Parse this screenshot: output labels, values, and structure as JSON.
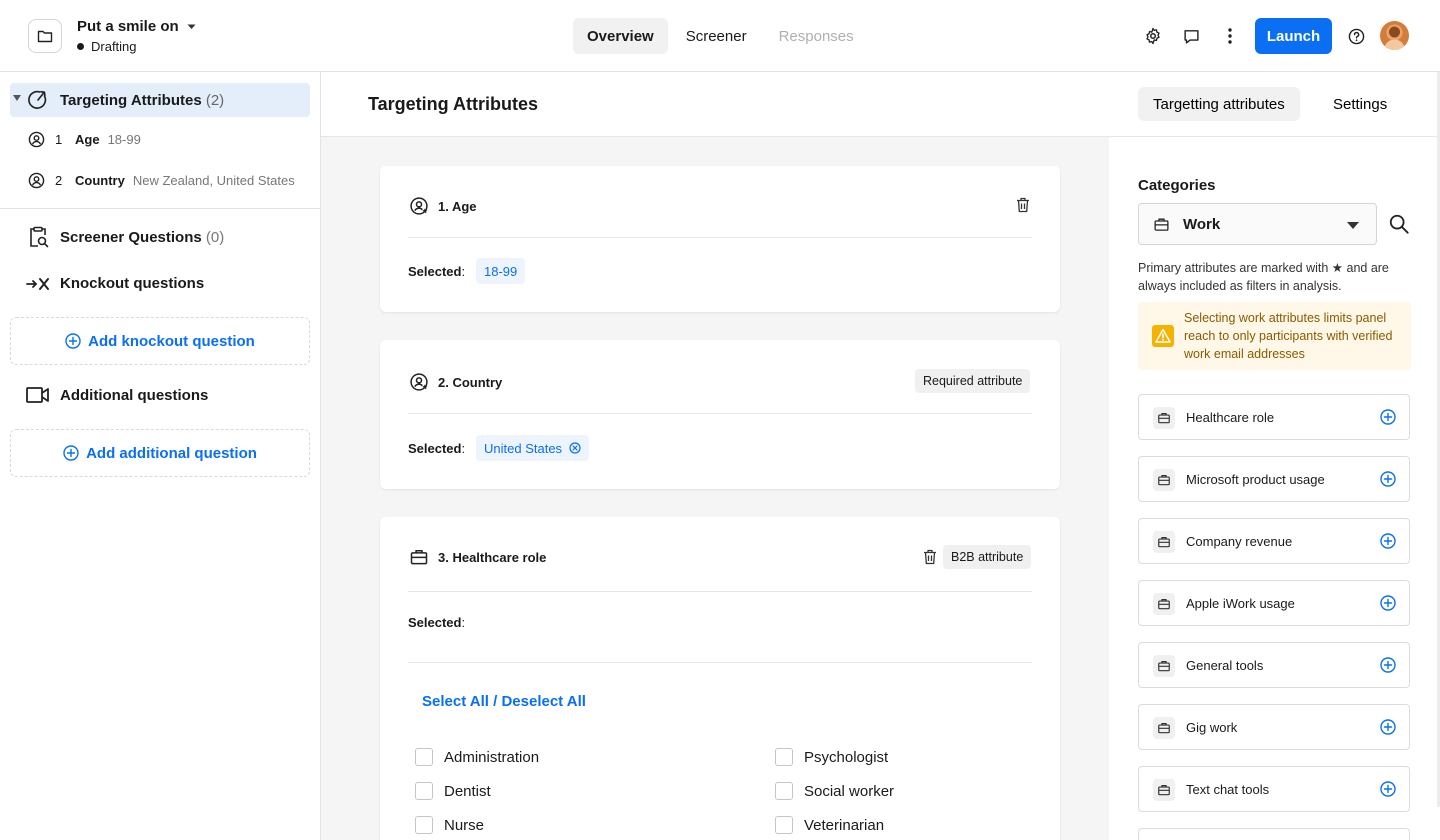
{
  "header": {
    "project_title": "Put a smile on",
    "status": "Drafting",
    "tabs": [
      "Overview",
      "Screener",
      "Responses"
    ],
    "launch_label": "Launch",
    "icons": [
      "settings-icon",
      "chat-icon",
      "more-icon",
      "help-icon"
    ]
  },
  "sidebar": {
    "targeting": {
      "label": "Targeting Attributes",
      "count": "(2)"
    },
    "attributes": [
      {
        "num": "1",
        "name": "Age",
        "value": "18-99"
      },
      {
        "num": "2",
        "name": "Country",
        "value": "New Zealand, United States"
      }
    ],
    "screener": {
      "label": "Screener Questions",
      "count": "(0)"
    },
    "knockout": {
      "label": "Knockout questions",
      "add_label": "Add knockout question"
    },
    "additional": {
      "label": "Additional questions",
      "add_label": "Add additional question"
    }
  },
  "main": {
    "title": "Targeting Attributes",
    "selected_label": "Selected",
    "cards": [
      {
        "title": "1. Age",
        "chip": "18-99"
      },
      {
        "title": "2. Country",
        "badge": "Required attribute",
        "chip": "United States"
      },
      {
        "title": "3. Healthcare role",
        "badge": "B2B attribute",
        "select_all": "Select All / Deselect All",
        "options_left": [
          "Administration",
          "Dentist",
          "Nurse"
        ],
        "options_right": [
          "Psychologist",
          "Social worker",
          "Veterinarian"
        ]
      }
    ]
  },
  "right_panel": {
    "tabs": [
      "Targetting attributes",
      "Settings"
    ],
    "categories_title": "Categories",
    "category_selected": "Work",
    "primary_note": "Primary attributes are marked with ★ and are always included as filters in analysis.",
    "warning": "Selecting work attributes limits panel reach to only participants with verified work email addresses",
    "attributes": [
      "Healthcare role",
      "Microsoft product usage",
      "Company revenue",
      "Apple iWork usage",
      "General tools",
      "Gig work",
      "Text chat tools"
    ]
  },
  "colors": {
    "accent": "#0a6ff2",
    "selected_bg": "#e4eefb",
    "warning_bg": "#fff8e8",
    "warning_text": "#8a5a00",
    "warning_icon": "#f5b301"
  }
}
